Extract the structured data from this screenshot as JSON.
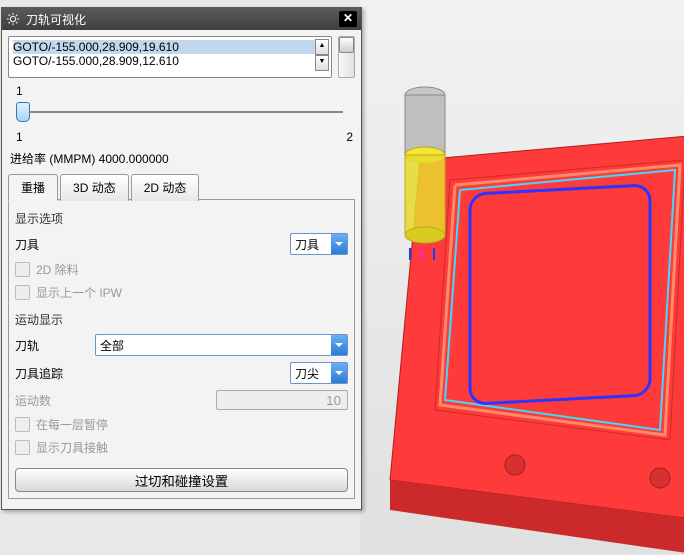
{
  "dialog": {
    "title": "刀轨可视化",
    "gcode": {
      "lines": [
        "GOTO/-155.000,28.909,19.610",
        "GOTO/-155.000,28.909,12.610"
      ]
    },
    "slider": {
      "min": "1",
      "max": "2",
      "current": "1"
    },
    "feedrate": "进给率 (MMPM) 4000.000000",
    "tabs": {
      "replay": "重播",
      "dyn3d": "3D 动态",
      "dyn2d": "2D 动态"
    },
    "display_options": {
      "heading": "显示选项",
      "tool_label": "刀具",
      "tool_value": "刀具",
      "exclude2d": "2D 除料",
      "show_prev_ipw": "显示上一个 IPW"
    },
    "motion_display": {
      "heading": "运动显示",
      "toolpath_label": "刀轨",
      "toolpath_value": "全部",
      "track_label": "刀具追踪",
      "track_value": "刀尖",
      "motion_count_label": "运动数",
      "motion_count_value": "10",
      "pause_each_layer": "在每一层暂停",
      "show_tool_contact": "显示刀具接触"
    },
    "collision_button": "过切和碰撞设置"
  }
}
